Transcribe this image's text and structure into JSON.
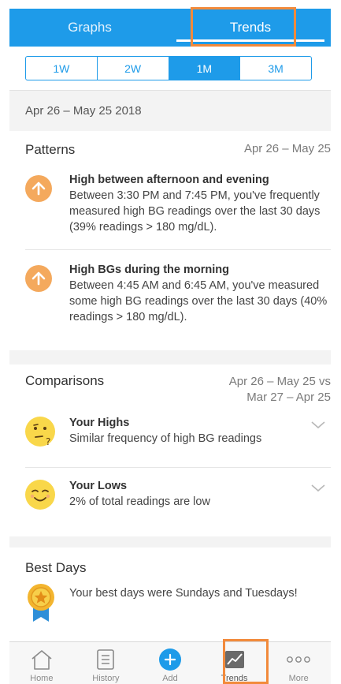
{
  "header": {
    "tabs": [
      {
        "label": "Graphs",
        "active": false
      },
      {
        "label": "Trends",
        "active": true
      }
    ]
  },
  "range_tabs": [
    {
      "label": "1W",
      "active": false
    },
    {
      "label": "2W",
      "active": false
    },
    {
      "label": "1M",
      "active": true
    },
    {
      "label": "3M",
      "active": false
    }
  ],
  "date_range": "Apr 26  – May 25 2018",
  "patterns": {
    "title": "Patterns",
    "range": "Apr 26 – May 25",
    "items": [
      {
        "icon": "arrow-up-icon",
        "title": "High between afternoon and evening",
        "body": "Between 3:30 PM and 7:45 PM, you've frequently measured high BG readings over the last 30 days (39% readings > 180 mg/dL)."
      },
      {
        "icon": "arrow-up-icon",
        "title": "High BGs during the morning",
        "body": "Between 4:45 AM and 6:45 AM, you've measured some high BG readings over the last 30 days (40% readings > 180 mg/dL)."
      }
    ]
  },
  "comparisons": {
    "title": "Comparisons",
    "range_line1": "Apr 26 – May 25 vs",
    "range_line2": "Mar 27 – Apr 25",
    "items": [
      {
        "icon": "thinking-face-icon",
        "title": "Your Highs",
        "body": "Similar frequency of high BG readings"
      },
      {
        "icon": "relieved-face-icon",
        "title": "Your Lows",
        "body": "2% of total readings are low"
      }
    ]
  },
  "best_days": {
    "title": "Best Days",
    "icon": "medal-icon",
    "body": "Your best days were Sundays and Tuesdays!"
  },
  "tabbar": [
    {
      "label": "Home",
      "icon": "home-icon",
      "active": false
    },
    {
      "label": "History",
      "icon": "history-icon",
      "active": false
    },
    {
      "label": "Add",
      "icon": "add-icon",
      "active": false
    },
    {
      "label": "Trends",
      "icon": "trends-icon",
      "active": true
    },
    {
      "label": "More",
      "icon": "more-icon",
      "active": false
    }
  ],
  "colors": {
    "accent": "#1e9be9",
    "highlight": "#f28a3b",
    "pattern_icon": "#f4a95d",
    "emoji": "#f9d74a"
  }
}
